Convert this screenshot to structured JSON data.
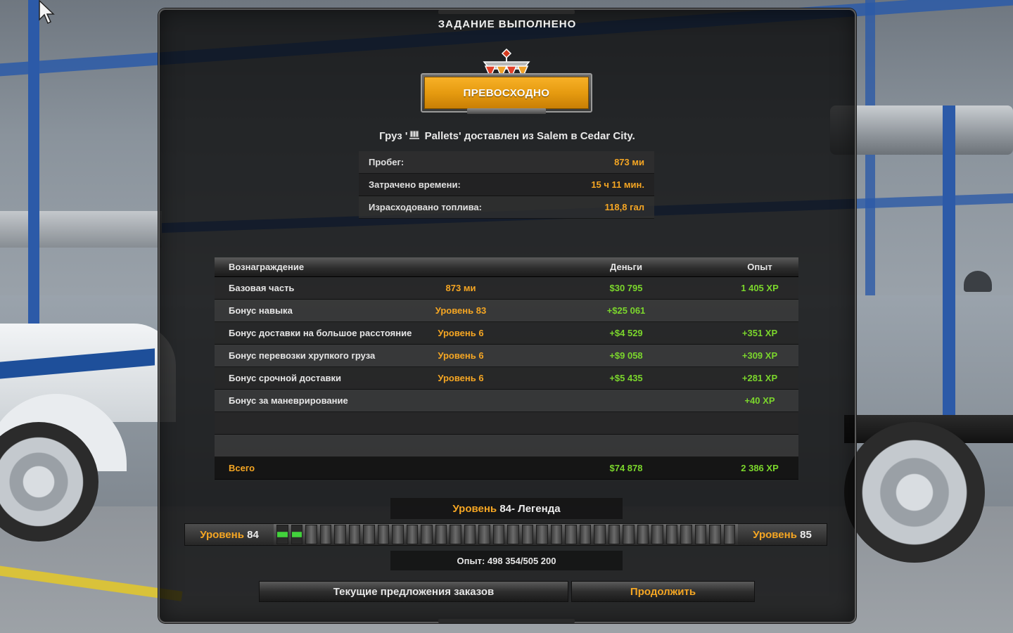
{
  "title": "ЗАДАНИЕ ВЫПОЛНЕНО",
  "rating": {
    "label": "ПРЕВОСХОДНО",
    "icon": "rating-emblem-icon"
  },
  "cargo": {
    "prefix": "Груз '",
    "name": "Pallets",
    "suffix": "' доставлен из Salem в Cedar City.",
    "icon": "cargo-pallet-icon"
  },
  "stats": [
    {
      "label": "Пробег:",
      "value": "873 ми"
    },
    {
      "label": "Затрачено времени:",
      "value": "15 ч 11 мин."
    },
    {
      "label": "Израсходовано топлива:",
      "value": "118,8 гал"
    }
  ],
  "rewards": {
    "headers": {
      "name": "Вознаграждение",
      "money": "Деньги",
      "xp": "Опыт"
    },
    "rows": [
      {
        "name": "Базовая часть",
        "mid": "873 ми",
        "money": "$30 795",
        "xp": "1 405 XP"
      },
      {
        "name": "Бонус навыка",
        "mid": "Уровень 83",
        "money": "+$25 061",
        "xp": ""
      },
      {
        "name": "Бонус доставки на большое расстояние",
        "mid": "Уровень 6",
        "money": "+$4 529",
        "xp": "+351 XP"
      },
      {
        "name": "Бонус перевозки хрупкого груза",
        "mid": "Уровень 6",
        "money": "+$9 058",
        "xp": "+309 XP"
      },
      {
        "name": "Бонус срочной доставки",
        "mid": "Уровень 6",
        "money": "+$5 435",
        "xp": "+281 XP"
      },
      {
        "name": "Бонус за маневрирование",
        "mid": "",
        "money": "",
        "xp": "+40 XP"
      },
      {
        "name": "",
        "mid": "",
        "money": "",
        "xp": ""
      },
      {
        "name": "",
        "mid": "",
        "money": "",
        "xp": ""
      }
    ],
    "total": {
      "name": "Всего",
      "money": "$74 878",
      "xp": "2 386 XP"
    }
  },
  "level": {
    "word": "Уровень",
    "current_number": "84",
    "title_suffix": " - Легенда",
    "next_number": "85",
    "progress_fraction": 0.05,
    "segments": 32,
    "xp_text": "Опыт: 498 354/505 200"
  },
  "buttons": {
    "offers": "Текущие предложения заказов",
    "continue": "Продолжить"
  },
  "colors": {
    "accent_orange": "#f5a623",
    "positive_green": "#7bd62c",
    "progress_green": "#42d13c",
    "badge_gold": "#e69b10"
  }
}
